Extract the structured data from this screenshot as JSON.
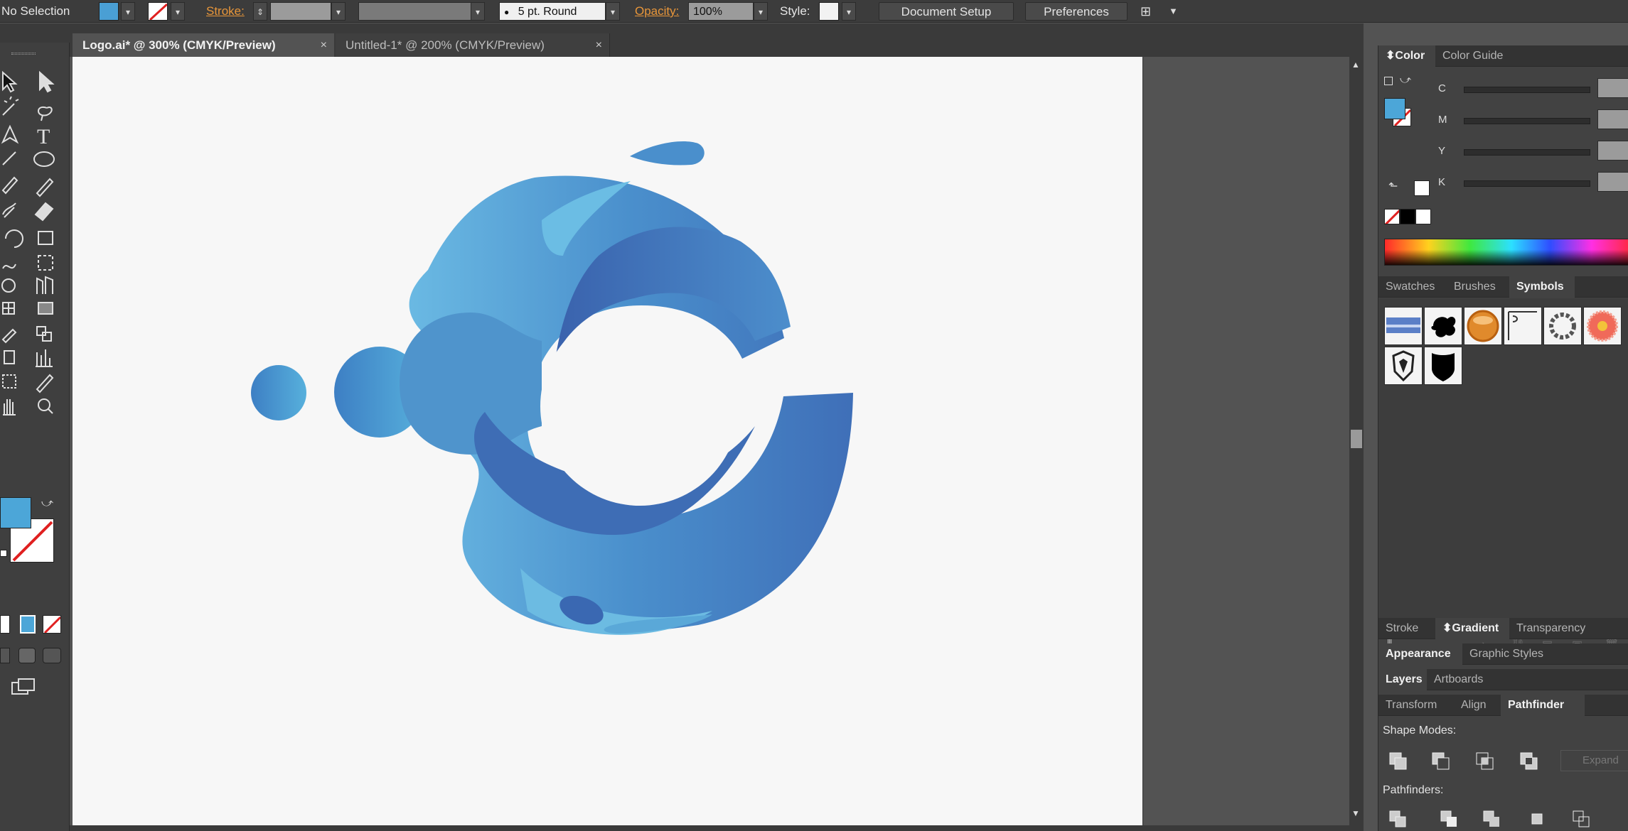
{
  "control_bar": {
    "selection_label": "No Selection",
    "stroke_label": "Stroke:",
    "brush_label": "5 pt. Round",
    "opacity_label": "Opacity:",
    "opacity_value": "100%",
    "style_label": "Style:",
    "document_setup": "Document Setup",
    "preferences": "Preferences",
    "fill_color": "#4a9fd4"
  },
  "doc_tabs": [
    {
      "label": "Logo.ai* @ 300% (CMYK/Preview)",
      "active": true
    },
    {
      "label": "Untitled-1* @ 200% (CMYK/Preview)",
      "active": false
    }
  ],
  "color_panel": {
    "tabs": [
      "Color",
      "Color Guide"
    ],
    "channels": [
      "C",
      "M",
      "Y",
      "K"
    ]
  },
  "symbols_panel": {
    "tabs": [
      "Swatches",
      "Brushes",
      "Symbols"
    ],
    "symbol_icons": [
      "blue-banner-icon",
      "ink-splat-icon",
      "orange-button-icon",
      "corner-flourish-icon",
      "wreath-icon",
      "flower-icon",
      "shield-outline-icon",
      "shield-black-icon"
    ]
  },
  "gradient_tabs": [
    "Stroke",
    "Gradient",
    "Transparency"
  ],
  "appearance_tabs": [
    "Appearance",
    "Graphic Styles"
  ],
  "layers_tabs": [
    "Layers",
    "Artboards"
  ],
  "pathfinder_tabs": [
    "Transform",
    "Align",
    "Pathfinder"
  ],
  "pathfinder": {
    "shape_modes_label": "Shape Modes:",
    "pathfinders_label": "Pathfinders:",
    "expand_label": "Expand"
  },
  "colors": {
    "logo_light": "#6bbde4",
    "logo_mid": "#4a8fcc",
    "logo_dark": "#3a62ad",
    "accent": "#e8963a"
  }
}
